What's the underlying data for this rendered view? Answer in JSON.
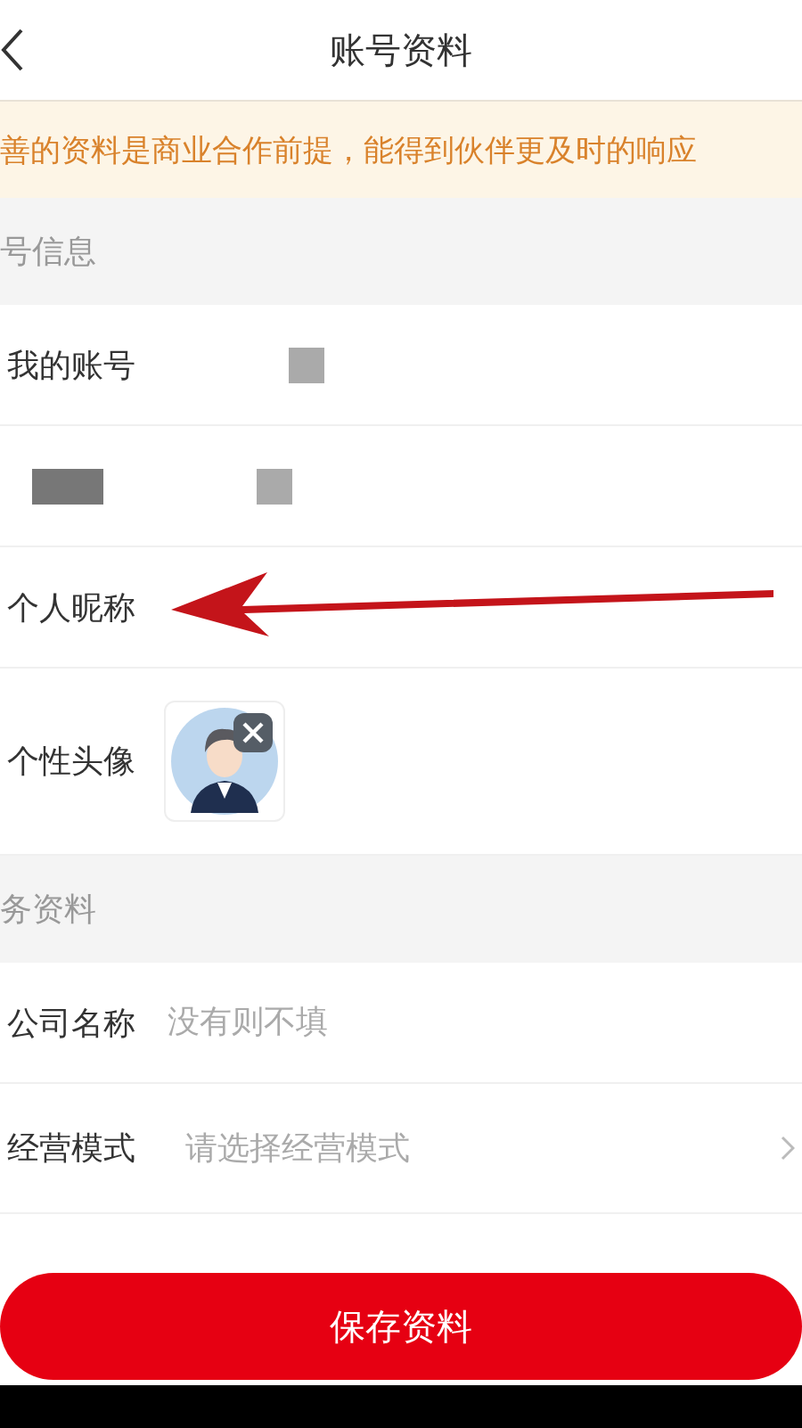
{
  "header": {
    "title": "账号资料"
  },
  "notice": "善的资料是商业合作前提，能得到伙伴更及时的响应",
  "sections": [
    {
      "title": "号信息",
      "rows": [
        {
          "kind": "redacted",
          "label": "我的账号"
        },
        {
          "kind": "redacted"
        },
        {
          "kind": "plain",
          "label": "个人昵称"
        },
        {
          "kind": "avatar",
          "label": "个性头像"
        }
      ]
    },
    {
      "title": "务资料",
      "rows": [
        {
          "kind": "input",
          "label": "公司名称",
          "placeholder": "没有则不填"
        },
        {
          "kind": "select",
          "label": "经营模式",
          "placeholder": "请选择经营模式"
        },
        {
          "kind": "cut"
        }
      ]
    }
  ],
  "save_button": "保存资料"
}
